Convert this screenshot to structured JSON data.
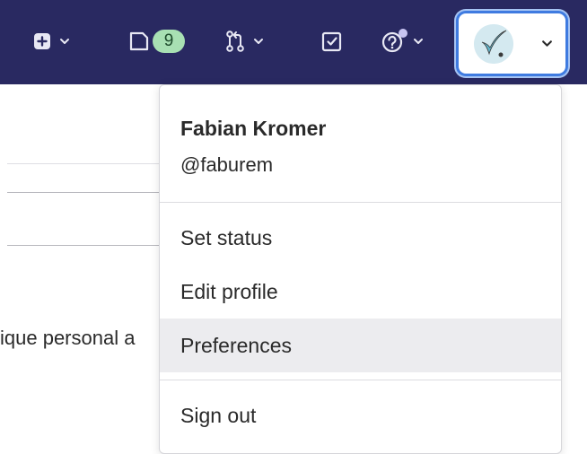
{
  "navbar": {
    "new_menu": {
      "icon": "plus-square-icon",
      "chevron": "chevron-down-icon"
    },
    "issues": {
      "icon": "issues-icon",
      "count": "9"
    },
    "merge_requests": {
      "icon": "merge-request-icon",
      "chevron": "chevron-down-icon"
    },
    "todos": {
      "icon": "todo-checkbox-icon"
    },
    "help": {
      "icon": "help-icon",
      "chevron": "chevron-down-icon"
    },
    "user_menu": {
      "icon": "avatar",
      "chevron": "chevron-down-icon"
    }
  },
  "background": {
    "text": "ique personal a"
  },
  "dropdown": {
    "name": "Fabian Kromer",
    "handle": "@faburem",
    "items": [
      {
        "label": "Set status"
      },
      {
        "label": "Edit profile"
      },
      {
        "label": "Preferences",
        "highlighted": true
      },
      {
        "label": "Sign out"
      }
    ]
  },
  "colors": {
    "navbar_bg": "#292961",
    "badge_bg": "#a8e0b3",
    "focus_ring": "#3f7be0",
    "menu_hover": "#ececef"
  }
}
